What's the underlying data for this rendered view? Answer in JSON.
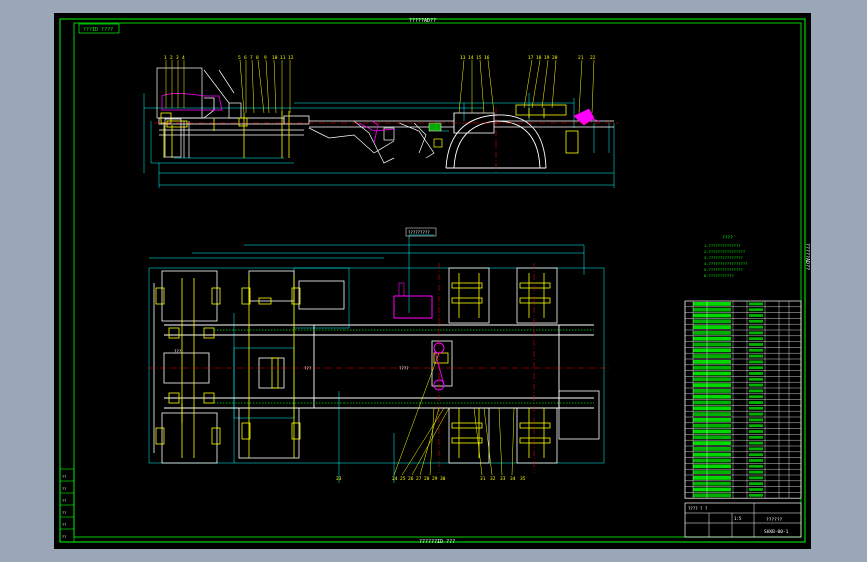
{
  "sheet": {
    "top_label": "?????AD??",
    "bottom_label": "??????ID ???",
    "side_label": "?????AD??",
    "top_left_box": "???ID ????",
    "tech_notes_title": "????",
    "tech_notes_lines": [
      "1.??????????????",
      "2.????????????????",
      "3.???????????????",
      "4.?????????????????",
      "5.???????????????",
      "6.???????????"
    ],
    "plan_callout": "?????????",
    "plan_label": "????",
    "mid_label_1": "???",
    "mid_label_2": "???"
  },
  "balloons": {
    "top_view_left": [
      "1",
      "2",
      "3",
      "4"
    ],
    "top_view_mid": [
      "5",
      "6",
      "7",
      "8",
      "9",
      "10",
      "11",
      "12"
    ],
    "top_view_right": [
      "13",
      "14",
      "15",
      "16",
      "17",
      "18",
      "19",
      "20",
      "21",
      "22"
    ],
    "plan_bottom": [
      "23",
      "24",
      "25",
      "26",
      "27",
      "28",
      "29",
      "30",
      "31",
      "32",
      "33",
      "34",
      "35"
    ]
  },
  "title_block": {
    "drawing_title": "??????",
    "drawing_number": "SHXB-00-1",
    "scale": "1:5",
    "sheet_info": "???? ? ?",
    "signature_rows": [
      "??",
      "??",
      "??",
      "??",
      "??",
      "??"
    ]
  },
  "bom": {
    "rows": 34
  },
  "colors": {
    "border": "#00ff00",
    "dimension": "#00ffff",
    "center_line": "#ff0000",
    "part_outline": "#ffffff",
    "highlight": "#ffff00",
    "accent": "#ff00ff",
    "background": "#000000"
  }
}
